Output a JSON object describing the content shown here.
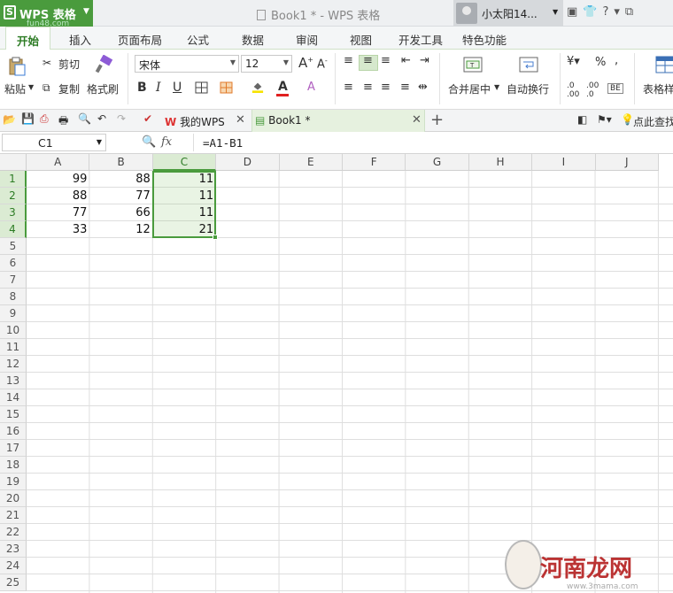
{
  "titlebar": {
    "app_name": "WPS 表格",
    "app_logo": "S",
    "watermark_url": "fun48.com",
    "document_title": "Book1 * - WPS 表格",
    "user_name": "小太阳14...",
    "help_label": "?"
  },
  "ribbon_tabs": [
    "开始",
    "插入",
    "页面布局",
    "公式",
    "数据",
    "审阅",
    "视图",
    "开发工具",
    "特色功能"
  ],
  "ribbon": {
    "paste": "粘贴",
    "cut": "剪切",
    "copy": "复制",
    "format_painter": "格式刷",
    "font_name": "宋体",
    "font_size": "12",
    "bold": "B",
    "italic": "I",
    "underline": "U",
    "merge_center": "合并居中",
    "wrap_text": "自动换行",
    "percent": "%",
    "table_style": "表格样"
  },
  "doc_tabs": {
    "my_wps": "我的WPS",
    "book": "Book1 *",
    "search_hint": "点此查找"
  },
  "formula_bar": {
    "cell_ref": "C1",
    "fx": "fx",
    "formula": "=A1-B1"
  },
  "columns": [
    "A",
    "B",
    "C",
    "D",
    "E",
    "F",
    "G",
    "H",
    "I",
    "J"
  ],
  "rows": [
    "1",
    "2",
    "3",
    "4",
    "5",
    "6",
    "7",
    "8",
    "9",
    "10",
    "11",
    "12",
    "13",
    "14",
    "15",
    "16",
    "17",
    "18",
    "19",
    "20",
    "21",
    "22",
    "23",
    "24",
    "25"
  ],
  "cells": {
    "A": [
      "99",
      "88",
      "77",
      "33"
    ],
    "B": [
      "88",
      "77",
      "66",
      "12"
    ],
    "C": [
      "11",
      "11",
      "11",
      "21"
    ]
  },
  "watermark": {
    "text": "河南龙网",
    "sub": "www.3mama.com"
  },
  "colors": {
    "accent_green": "#4a9b3d",
    "selection_fill": "#dbebd3"
  }
}
